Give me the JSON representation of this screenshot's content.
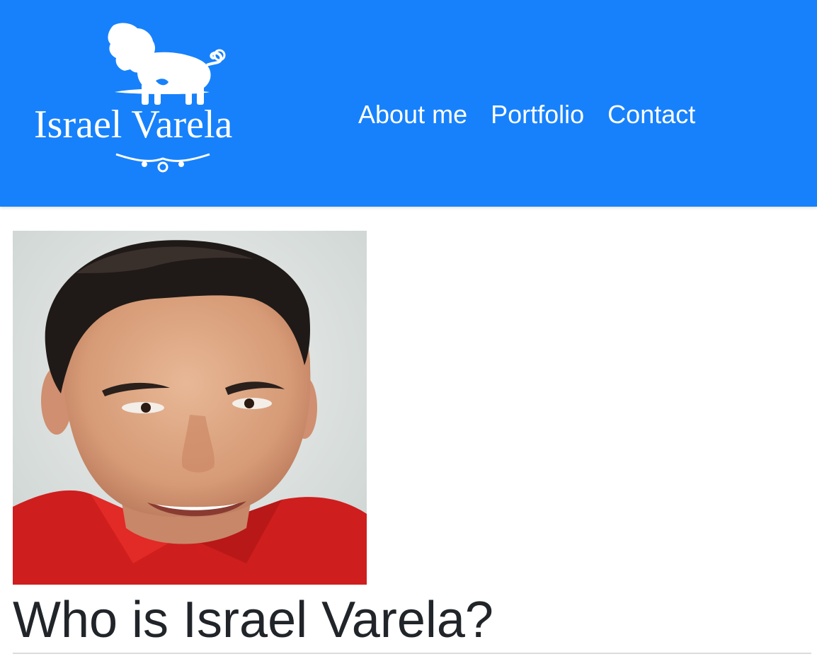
{
  "colors": {
    "nav_background": "#1781fb",
    "nav_text": "#ffffff",
    "heading_text": "#212529",
    "divider": "#dcdcdc"
  },
  "brand": {
    "name": "Israel Varela",
    "emblem": "lion-icon",
    "ornament": "flourish-ornament"
  },
  "nav": {
    "items": [
      {
        "label": "About me"
      },
      {
        "label": "Portfolio"
      },
      {
        "label": "Contact"
      }
    ]
  },
  "portrait": {
    "alt": "portrait photo"
  },
  "main": {
    "heading": "Who is Israel Varela?"
  }
}
